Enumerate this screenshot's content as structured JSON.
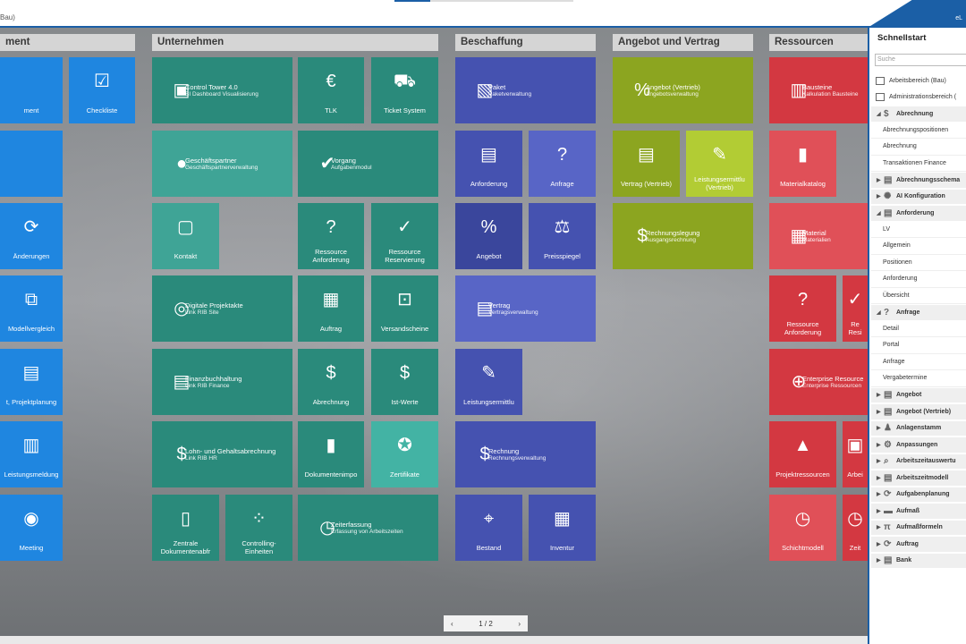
{
  "header": {
    "left_text": "Bau)",
    "right_text": "eL"
  },
  "groups": [
    {
      "id": "g0",
      "title": "ment"
    },
    {
      "id": "g1",
      "title": "Unternehmen"
    },
    {
      "id": "g2",
      "title": "Beschaffung"
    },
    {
      "id": "g3",
      "title": "Angebot und Vertrag"
    },
    {
      "id": "g4",
      "title": "Ressourcen"
    }
  ],
  "tiles": {
    "t01": {
      "label": "ment",
      "icon": "management-icon"
    },
    "t02": {
      "label": "Checkliste",
      "icon": "checklist-icon"
    },
    "t03": {
      "label": "",
      "icon": "blank-icon"
    },
    "t04": {
      "label": "Änderungen",
      "icon": "changes-icon"
    },
    "t05": {
      "label": "Modellvergleich",
      "icon": "model-compare-icon"
    },
    "t06": {
      "label": "t, Projektplanung",
      "icon": "planning-icon"
    },
    "t07": {
      "label": "Leistungsmeldung",
      "icon": "performance-report-icon"
    },
    "t08": {
      "label": "Meeting",
      "icon": "meeting-icon"
    },
    "t11": {
      "title": "Control Tower 4.0",
      "sub": "BI Dashboard Visualisierung",
      "icon": "dashboard-icon"
    },
    "t12": {
      "label": "TLK",
      "icon": "money-bag-icon"
    },
    "t13": {
      "label": "Ticket System",
      "icon": "cart-icon"
    },
    "t14": {
      "title": "Geschäftspartner",
      "sub": "Geschäftspartnerverwaltung",
      "icon": "business-partner-icon"
    },
    "t15": {
      "title": "Vorgang",
      "sub": "Aufgabenmodul",
      "icon": "task-check-icon"
    },
    "t16": {
      "label": "Kontakt",
      "icon": "contact-icon"
    },
    "t17": {
      "label": "Ressource\nAnforderung",
      "icon": "resource-request-icon"
    },
    "t18": {
      "label": "Ressource\nReservierung",
      "icon": "resource-reservation-icon"
    },
    "t19": {
      "title": "Digitale Projektakte",
      "sub": "Link RIB Site",
      "icon": "project-file-icon"
    },
    "t20": {
      "label": "Auftrag",
      "icon": "order-icon"
    },
    "t21": {
      "label": "Versandscheine",
      "icon": "shipping-icon"
    },
    "t22": {
      "title": "Finanzbuchhaltung",
      "sub": "Link RIB Finance",
      "icon": "finance-icon"
    },
    "t23": {
      "label": "Abrechnung",
      "icon": "billing-icon"
    },
    "t24": {
      "label": "Ist-Werte",
      "icon": "actual-values-icon"
    },
    "t25": {
      "title": "Lohn- und Gehaltsabrechnung",
      "sub": "Link RIB HR",
      "icon": "payroll-icon"
    },
    "t26": {
      "label": "Dokumentenimpo",
      "icon": "document-import-icon"
    },
    "t27": {
      "label": "Zertifikate",
      "icon": "certificate-icon"
    },
    "t28": {
      "label": "Zentrale\nDokumentenabfr",
      "icon": "document-query-icon"
    },
    "t29": {
      "label": "Controlling-\nEinheiten",
      "icon": "controlling-icon"
    },
    "t30": {
      "title": "Zeiterfassung",
      "sub": "Erfassung von Arbeitszeiten",
      "icon": "time-tracking-icon"
    },
    "t31": {
      "title": "Paket",
      "sub": "Paketverwaltung",
      "icon": "package-icon"
    },
    "t32": {
      "label": "Anforderung",
      "icon": "requisition-icon"
    },
    "t33": {
      "label": "Anfrage",
      "icon": "inquiry-icon"
    },
    "t34": {
      "label": "Angebot",
      "icon": "quote-icon"
    },
    "t35": {
      "label": "Preisspiegel",
      "icon": "scales-icon"
    },
    "t36": {
      "title": "Vertrag",
      "sub": "Vertragsverwaltung",
      "icon": "contract-icon"
    },
    "t37": {
      "label": "Leistungsermittlu",
      "icon": "service-determination-icon"
    },
    "t38": {
      "title": "Rechnung",
      "sub": "Rechnungsverwaltung",
      "icon": "invoice-icon"
    },
    "t39": {
      "label": "Bestand",
      "icon": "stock-icon"
    },
    "t40": {
      "label": "Inventur",
      "icon": "inventory-icon"
    },
    "t41": {
      "title": "Angebot (Vertrieb)",
      "sub": "Angebotsverwaltung",
      "icon": "sales-quote-icon"
    },
    "t42": {
      "label": "Vertrag (Vertrieb)",
      "icon": "sales-contract-icon"
    },
    "t43": {
      "label": "Leistungsermittlu\n(Vertrieb)",
      "icon": "wrench-icon"
    },
    "t44": {
      "title": "Rechnungslegung",
      "sub": "Ausgangsrechnung",
      "icon": "billing-out-icon"
    },
    "t51": {
      "title": "Bausteine",
      "sub": "Kalkulation Bausteine",
      "icon": "building-blocks-icon"
    },
    "t52": {
      "label": "Materialkatalog",
      "icon": "material-catalog-icon"
    },
    "t53": {
      "title": "Material",
      "sub": "Materialien",
      "icon": "material-icon"
    },
    "t54": {
      "label": "Ressource\nAnforderung",
      "icon": "resource-request-icon"
    },
    "t55": {
      "label": "Re\nResi",
      "icon": "resource-reservation-icon"
    },
    "t56": {
      "title": "Enterprise Resource",
      "sub": "Enterprise Ressourcen",
      "icon": "enterprise-icon"
    },
    "t57": {
      "label": "Projektressourcen",
      "icon": "project-resource-icon"
    },
    "t58": {
      "label": "Arbei",
      "icon": "work-icon"
    },
    "t59": {
      "label": "Schichtmodell",
      "icon": "shift-model-icon"
    },
    "t60": {
      "label": "Zeit",
      "icon": "time-icon"
    }
  },
  "pager": {
    "prev": "‹",
    "label": "1 / 2",
    "next": "›"
  },
  "quickstart": {
    "title": "Schnellstart",
    "search_placeholder": "Suche",
    "workspaces": [
      "Arbeitsbereich (Bau)",
      "Administrationsbereich ("
    ],
    "sections": [
      {
        "name": "Abrechnung",
        "open": true,
        "items": [
          "Abrechnungspositionen",
          "Abrechnung",
          "Transaktionen Finance"
        ]
      },
      {
        "name": "Abrechnungsschema",
        "open": false,
        "items": []
      },
      {
        "name": "AI Konfiguration",
        "open": false,
        "items": []
      },
      {
        "name": "Anforderung",
        "open": true,
        "items": [
          "LV",
          "Allgemein",
          "Positionen",
          "Anforderung",
          "Übersicht"
        ]
      },
      {
        "name": "Anfrage",
        "open": true,
        "items": [
          "Detail",
          "Portal",
          "Anfrage",
          "Vergabetermine"
        ]
      },
      {
        "name": "Angebot",
        "open": false,
        "items": []
      },
      {
        "name": "Angebot (Vertrieb)",
        "open": false,
        "items": []
      },
      {
        "name": "Anlagenstamm",
        "open": false,
        "items": []
      },
      {
        "name": "Anpassungen",
        "open": false,
        "items": []
      },
      {
        "name": "Arbeitszeitauswertu",
        "open": false,
        "items": []
      },
      {
        "name": "Arbeitszeitmodell",
        "open": false,
        "items": []
      },
      {
        "name": "Aufgabenplanung",
        "open": false,
        "items": []
      },
      {
        "name": "Aufmaß",
        "open": false,
        "items": []
      },
      {
        "name": "Aufmaßformeln",
        "open": false,
        "items": []
      },
      {
        "name": "Auftrag",
        "open": false,
        "items": []
      },
      {
        "name": "Bank",
        "open": false,
        "items": []
      }
    ]
  }
}
